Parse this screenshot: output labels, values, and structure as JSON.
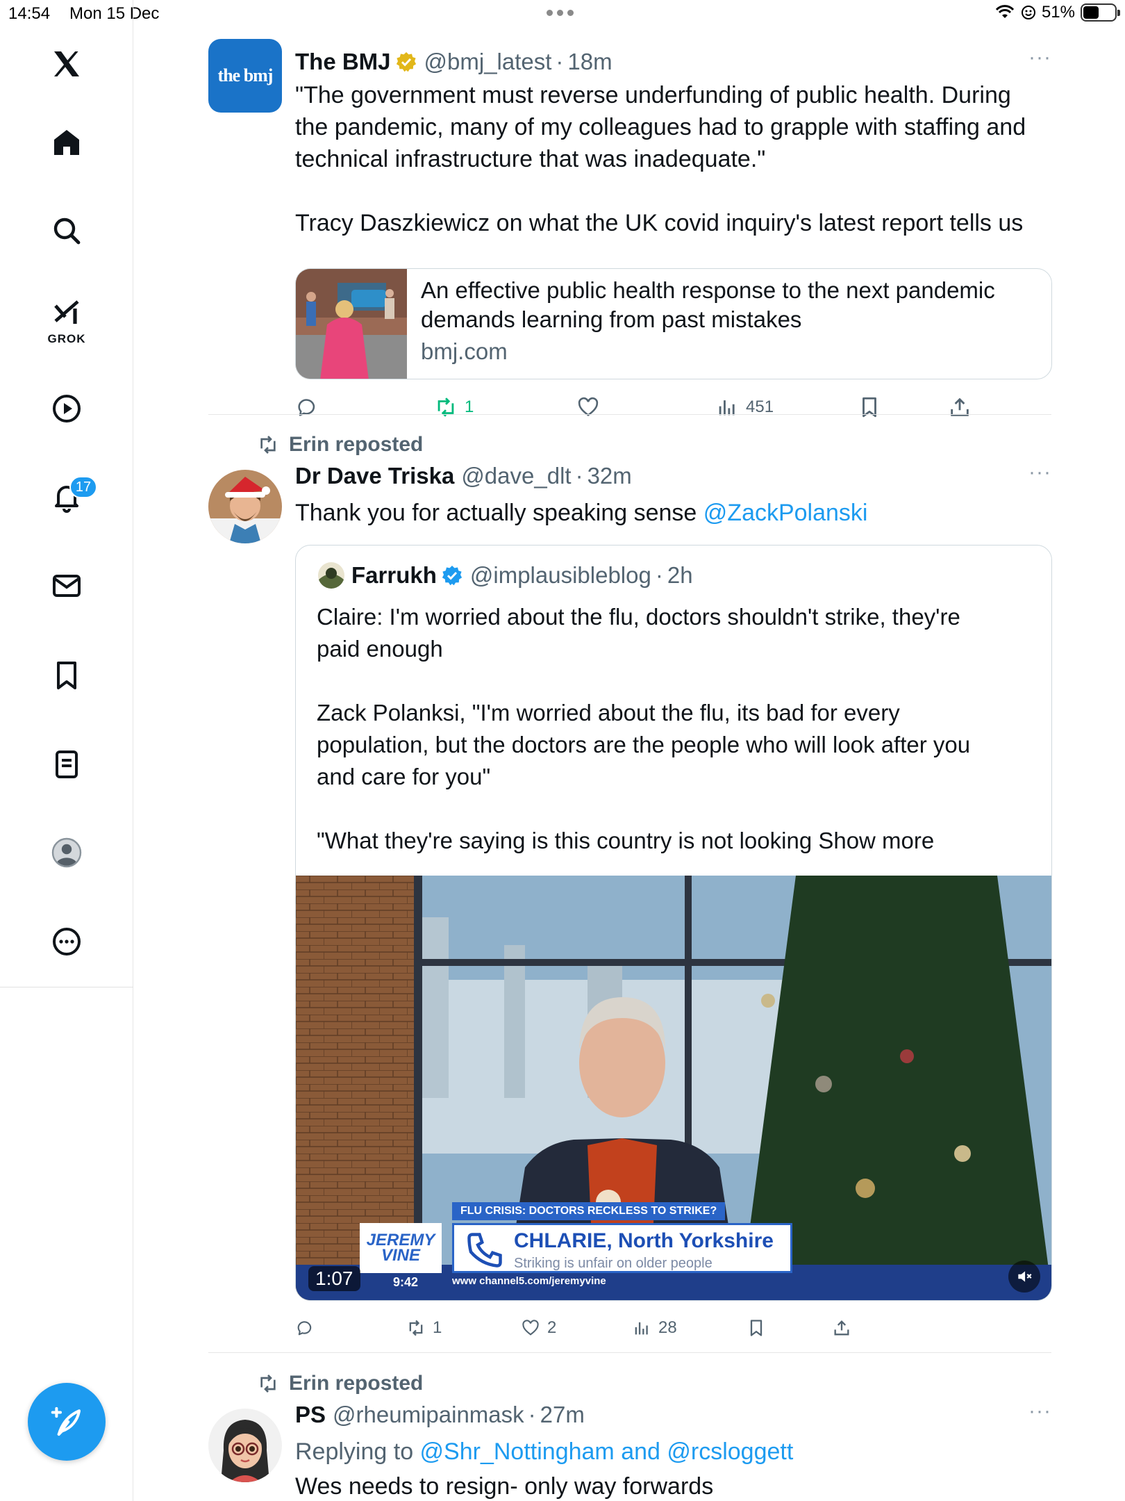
{
  "status_bar": {
    "time": "14:54",
    "date": "Mon 15 Dec",
    "battery": "51%"
  },
  "sidebar": {
    "grok_label": "GROK",
    "notifications_badge": "17",
    "items": [
      "x-logo",
      "home-icon",
      "search-icon",
      "grok-icon",
      "video-icon",
      "notifications-icon",
      "messages-icon",
      "bookmarks-icon",
      "lists-icon",
      "profile-icon",
      "more-icon"
    ]
  },
  "posts": [
    {
      "name": "The BMJ",
      "avatar_text": "the bmj",
      "handle": "@bmj_latest",
      "time": "18m",
      "more": "···",
      "text_lines": [
        "\"The government must reverse underfunding of public health. During",
        "the pandemic, many of my colleagues had to grapple with staffing and",
        "technical infrastructure that was inadequate.\""
      ],
      "text_2": "Tracy Daszkiewicz on what the UK covid inquiry's latest report tells us",
      "card": {
        "title_lines": [
          "An effective public health response to the next pandemic",
          "demands learning from past mistakes"
        ],
        "domain": "bmj.com"
      },
      "actions": {
        "reposts": "1",
        "views": "451"
      }
    },
    {
      "reposted_by": "Erin reposted",
      "name": "Dr Dave Triska",
      "handle": "@dave_dlt",
      "time": "32m",
      "more": "···",
      "text": "Thank you for actually speaking sense ",
      "mention": "@ZackPolanski",
      "quote": {
        "name": "Farrukh",
        "handle": "@implausibleblog",
        "time": "2h",
        "text_1": "Claire: I'm worried about the flu, doctors shouldn't strike, they're",
        "text_1b": "paid enough",
        "text_2": "Zack Polanksi, \"I'm worried about the flu, its bad for every",
        "text_2b": "population, but the doctors are the people who will look after you",
        "text_2c": "and care for you\"",
        "text_3": "\"What they're saying is this country is not looking ",
        "show_more": "Show more",
        "video": {
          "duration": "1:07",
          "tag": "FLU CRISIS: DOCTORS RECKLESS TO STRIKE?",
          "caller": "CHLARIE, North Yorkshire",
          "caller_sub": "Striking is unfair on older people",
          "show_logo": "JEREMY VINE",
          "clock": "9:42",
          "url": "www  channel5.com/jeremyvine"
        }
      },
      "actions": {
        "reposts": "1",
        "likes": "2",
        "views": "28"
      }
    },
    {
      "reposted_by": "Erin reposted",
      "name": "PS",
      "handle": "@rheumipainmask",
      "time": "27m",
      "more": "···",
      "replying_prefix": "Replying to ",
      "replying_to": "@Shr_Nottingham and @rcsloggett",
      "text": "Wes needs to resign- only way forwards"
    }
  ],
  "colors": {
    "accent": "#1d9bf0",
    "repost_green": "#00ba7c",
    "muted": "#536471",
    "bmj_blue": "#1a73c8"
  }
}
